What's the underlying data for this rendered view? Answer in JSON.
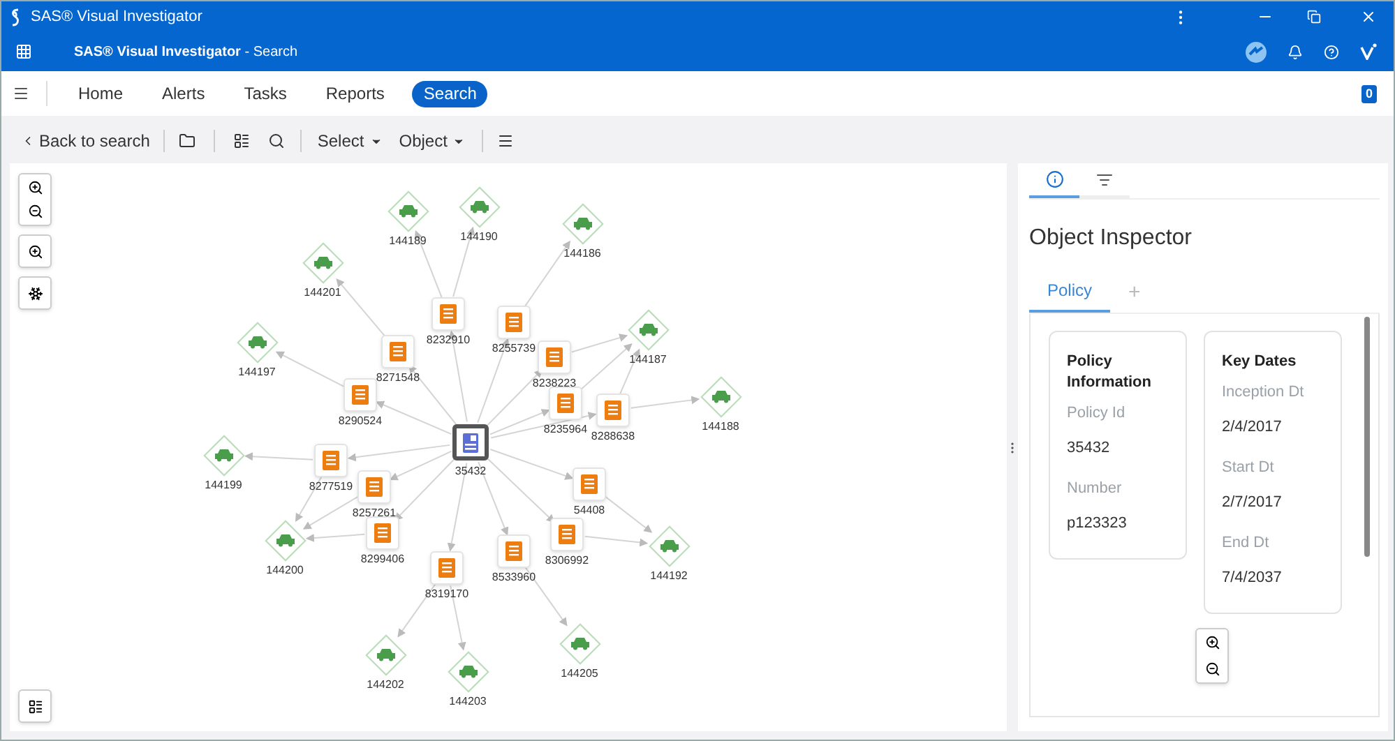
{
  "title_bar": {
    "title": "SAS® Visual Investigator"
  },
  "app_bar": {
    "title": "SAS® Visual Investigator",
    "subtitle": " - Search"
  },
  "nav": {
    "items": [
      {
        "label": "Home",
        "selected": false
      },
      {
        "label": "Alerts",
        "selected": false
      },
      {
        "label": "Tasks",
        "selected": false
      },
      {
        "label": "Reports",
        "selected": false
      },
      {
        "label": "Search",
        "selected": true
      }
    ],
    "badge": "0"
  },
  "toolbar": {
    "back": "Back to search",
    "dropdowns": [
      "Select",
      "Object"
    ]
  },
  "graph": {
    "nodes": [
      {
        "kind": "policy",
        "label": "35432",
        "selected": true
      },
      {
        "kind": "claim",
        "label": "8232910",
        "selected": false
      },
      {
        "kind": "claim",
        "label": "8255739",
        "selected": false
      },
      {
        "kind": "claim",
        "label": "8271548",
        "selected": false
      },
      {
        "kind": "claim",
        "label": "8290524",
        "selected": false
      },
      {
        "kind": "claim",
        "label": "8238223",
        "selected": false
      },
      {
        "kind": "claim",
        "label": "8235964",
        "selected": false
      },
      {
        "kind": "claim",
        "label": "8288638",
        "selected": false
      },
      {
        "kind": "claim",
        "label": "8277519",
        "selected": false
      },
      {
        "kind": "claim",
        "label": "8257261",
        "selected": false
      },
      {
        "kind": "claim",
        "label": "8299406",
        "selected": false
      },
      {
        "kind": "claim",
        "label": "54408",
        "selected": false
      },
      {
        "kind": "claim",
        "label": "8306992",
        "selected": false
      },
      {
        "kind": "claim",
        "label": "8533960",
        "selected": false
      },
      {
        "kind": "claim",
        "label": "8319170",
        "selected": false
      },
      {
        "kind": "vehicle",
        "label": "144189",
        "selected": false
      },
      {
        "kind": "vehicle",
        "label": "144190",
        "selected": false
      },
      {
        "kind": "vehicle",
        "label": "144186",
        "selected": false
      },
      {
        "kind": "vehicle",
        "label": "144201",
        "selected": false
      },
      {
        "kind": "vehicle",
        "label": "144197",
        "selected": false
      },
      {
        "kind": "vehicle",
        "label": "144187",
        "selected": false
      },
      {
        "kind": "vehicle",
        "label": "144188",
        "selected": false
      },
      {
        "kind": "vehicle",
        "label": "144199",
        "selected": false
      },
      {
        "kind": "vehicle",
        "label": "144200",
        "selected": false
      },
      {
        "kind": "vehicle",
        "label": "144192",
        "selected": false
      },
      {
        "kind": "vehicle",
        "label": "144202",
        "selected": false
      },
      {
        "kind": "vehicle",
        "label": "144203",
        "selected": false
      },
      {
        "kind": "vehicle",
        "label": "144205",
        "selected": false
      }
    ]
  },
  "inspector": {
    "tabs": [
      {
        "kind": "info",
        "selected": true
      },
      {
        "kind": "selection",
        "selected": false
      }
    ],
    "title": "Object Inspector",
    "object_tabs": [
      {
        "label": "Policy",
        "selected": true
      },
      {
        "label": "+",
        "selected": false
      }
    ],
    "cards": [
      {
        "title": "Policy Information",
        "fields": [
          {
            "label": "Policy Id",
            "value": "35432"
          },
          {
            "label": "Number",
            "value": "p123323"
          }
        ]
      },
      {
        "title": "Key Dates",
        "fields": [
          {
            "label": "Inception Dt",
            "value": "2/4/2017"
          },
          {
            "label": "Start Dt",
            "value": "2/7/2017"
          },
          {
            "label": "End Dt",
            "value": "7/4/2037"
          }
        ]
      }
    ]
  }
}
